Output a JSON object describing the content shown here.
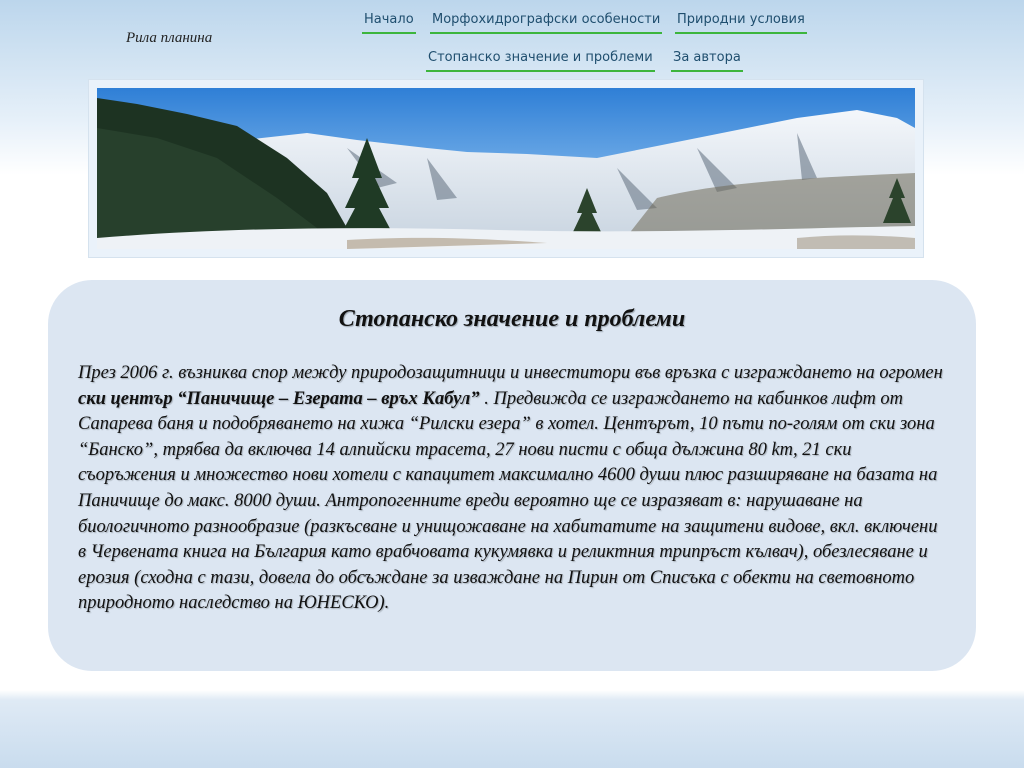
{
  "header": {
    "site_title": "Рила планина"
  },
  "nav": {
    "items": [
      {
        "label": "Начало"
      },
      {
        "label": "Морфохидрографски особености"
      },
      {
        "label": "Природни условия"
      },
      {
        "label": "Стопанско значение и проблеми"
      },
      {
        "label": "За автора"
      }
    ]
  },
  "article": {
    "title": "Стопанско значение и проблеми",
    "paragraph": {
      "before": "През 2006 г. възниква спор между природозащитници и инвеститори във връзка с изграждането на огромен ",
      "bold": "ски център “Паничище – Езерата – връх Кабул”",
      "after": " . Предвижда се изграждането на кабинков лифт от Сапарева баня и подобряването на хижа “Рилски езера” в хотел. Центърът, 10 пъти по-голям от ски зона “Банско”, трябва да включва 14 алпийски трасета, 27 нови писти с обща дължина 80 km, 21 ски съоръжения и множество нови хотели с капацитет максимално 4600 души плюс разширяване на базата на Паничище до макс. 8000 души. Антропогенните вреди вероятно ще се изразяват в: нарушаване на биологичното разнообразие (разкъсване и унищожаване на хабитатите на защитени видове, вкл. включени в Червената книга на България като врабчовата кукумявка и реликтния трипръст кълвач), обезлесяване и ерозия (сходна с тази, довела до обсъждане за изваждане на Пирин от Списъка с обекти на световното природното наследство на ЮНЕСКО)."
    }
  }
}
